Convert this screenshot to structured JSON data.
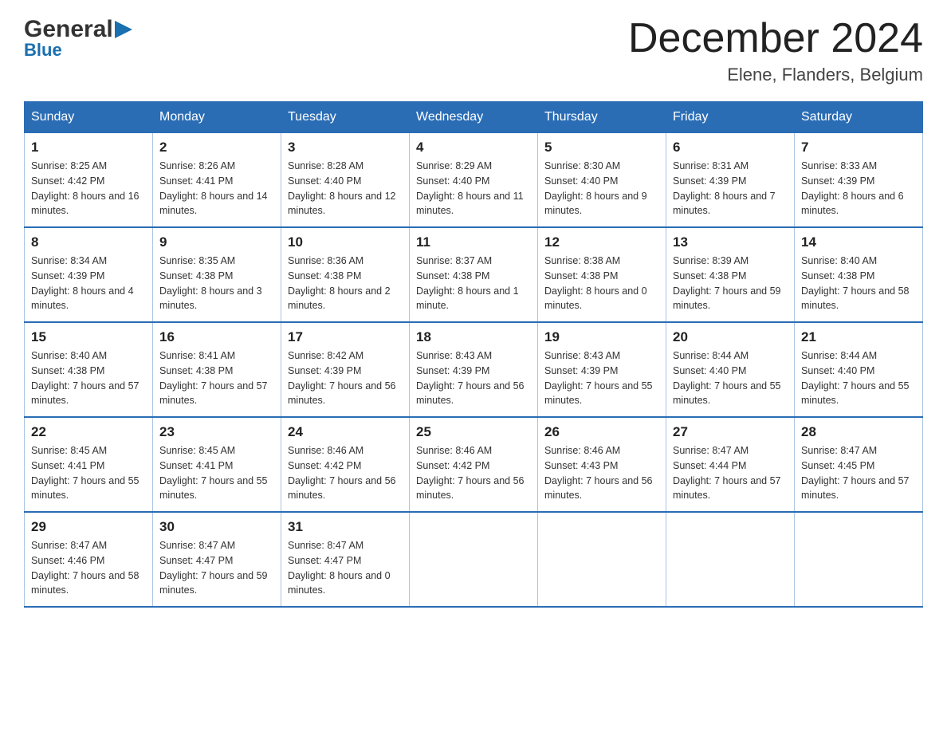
{
  "header": {
    "logo_general": "General",
    "logo_blue": "Blue",
    "month_title": "December 2024",
    "location": "Elene, Flanders, Belgium"
  },
  "weekdays": [
    "Sunday",
    "Monday",
    "Tuesday",
    "Wednesday",
    "Thursday",
    "Friday",
    "Saturday"
  ],
  "weeks": [
    [
      {
        "day": "1",
        "sunrise": "8:25 AM",
        "sunset": "4:42 PM",
        "daylight": "8 hours and 16 minutes."
      },
      {
        "day": "2",
        "sunrise": "8:26 AM",
        "sunset": "4:41 PM",
        "daylight": "8 hours and 14 minutes."
      },
      {
        "day": "3",
        "sunrise": "8:28 AM",
        "sunset": "4:40 PM",
        "daylight": "8 hours and 12 minutes."
      },
      {
        "day": "4",
        "sunrise": "8:29 AM",
        "sunset": "4:40 PM",
        "daylight": "8 hours and 11 minutes."
      },
      {
        "day": "5",
        "sunrise": "8:30 AM",
        "sunset": "4:40 PM",
        "daylight": "8 hours and 9 minutes."
      },
      {
        "day": "6",
        "sunrise": "8:31 AM",
        "sunset": "4:39 PM",
        "daylight": "8 hours and 7 minutes."
      },
      {
        "day": "7",
        "sunrise": "8:33 AM",
        "sunset": "4:39 PM",
        "daylight": "8 hours and 6 minutes."
      }
    ],
    [
      {
        "day": "8",
        "sunrise": "8:34 AM",
        "sunset": "4:39 PM",
        "daylight": "8 hours and 4 minutes."
      },
      {
        "day": "9",
        "sunrise": "8:35 AM",
        "sunset": "4:38 PM",
        "daylight": "8 hours and 3 minutes."
      },
      {
        "day": "10",
        "sunrise": "8:36 AM",
        "sunset": "4:38 PM",
        "daylight": "8 hours and 2 minutes."
      },
      {
        "day": "11",
        "sunrise": "8:37 AM",
        "sunset": "4:38 PM",
        "daylight": "8 hours and 1 minute."
      },
      {
        "day": "12",
        "sunrise": "8:38 AM",
        "sunset": "4:38 PM",
        "daylight": "8 hours and 0 minutes."
      },
      {
        "day": "13",
        "sunrise": "8:39 AM",
        "sunset": "4:38 PM",
        "daylight": "7 hours and 59 minutes."
      },
      {
        "day": "14",
        "sunrise": "8:40 AM",
        "sunset": "4:38 PM",
        "daylight": "7 hours and 58 minutes."
      }
    ],
    [
      {
        "day": "15",
        "sunrise": "8:40 AM",
        "sunset": "4:38 PM",
        "daylight": "7 hours and 57 minutes."
      },
      {
        "day": "16",
        "sunrise": "8:41 AM",
        "sunset": "4:38 PM",
        "daylight": "7 hours and 57 minutes."
      },
      {
        "day": "17",
        "sunrise": "8:42 AM",
        "sunset": "4:39 PM",
        "daylight": "7 hours and 56 minutes."
      },
      {
        "day": "18",
        "sunrise": "8:43 AM",
        "sunset": "4:39 PM",
        "daylight": "7 hours and 56 minutes."
      },
      {
        "day": "19",
        "sunrise": "8:43 AM",
        "sunset": "4:39 PM",
        "daylight": "7 hours and 55 minutes."
      },
      {
        "day": "20",
        "sunrise": "8:44 AM",
        "sunset": "4:40 PM",
        "daylight": "7 hours and 55 minutes."
      },
      {
        "day": "21",
        "sunrise": "8:44 AM",
        "sunset": "4:40 PM",
        "daylight": "7 hours and 55 minutes."
      }
    ],
    [
      {
        "day": "22",
        "sunrise": "8:45 AM",
        "sunset": "4:41 PM",
        "daylight": "7 hours and 55 minutes."
      },
      {
        "day": "23",
        "sunrise": "8:45 AM",
        "sunset": "4:41 PM",
        "daylight": "7 hours and 55 minutes."
      },
      {
        "day": "24",
        "sunrise": "8:46 AM",
        "sunset": "4:42 PM",
        "daylight": "7 hours and 56 minutes."
      },
      {
        "day": "25",
        "sunrise": "8:46 AM",
        "sunset": "4:42 PM",
        "daylight": "7 hours and 56 minutes."
      },
      {
        "day": "26",
        "sunrise": "8:46 AM",
        "sunset": "4:43 PM",
        "daylight": "7 hours and 56 minutes."
      },
      {
        "day": "27",
        "sunrise": "8:47 AM",
        "sunset": "4:44 PM",
        "daylight": "7 hours and 57 minutes."
      },
      {
        "day": "28",
        "sunrise": "8:47 AM",
        "sunset": "4:45 PM",
        "daylight": "7 hours and 57 minutes."
      }
    ],
    [
      {
        "day": "29",
        "sunrise": "8:47 AM",
        "sunset": "4:46 PM",
        "daylight": "7 hours and 58 minutes."
      },
      {
        "day": "30",
        "sunrise": "8:47 AM",
        "sunset": "4:47 PM",
        "daylight": "7 hours and 59 minutes."
      },
      {
        "day": "31",
        "sunrise": "8:47 AM",
        "sunset": "4:47 PM",
        "daylight": "8 hours and 0 minutes."
      },
      null,
      null,
      null,
      null
    ]
  ]
}
